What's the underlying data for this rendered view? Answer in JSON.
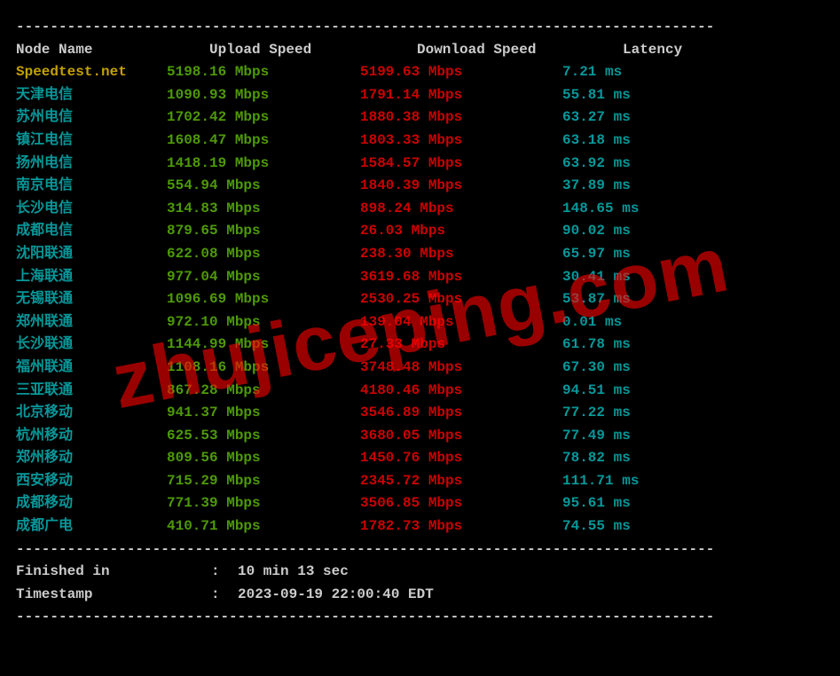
{
  "divider": "----------------------------------------------------------------------------------",
  "headers": {
    "node": "Node Name",
    "upload": "Upload Speed",
    "download": "Download Speed",
    "latency": "Latency"
  },
  "first_row": {
    "node": "Speedtest.net",
    "upload": "5198.16 Mbps",
    "download": "5199.63 Mbps",
    "latency": "7.21 ms"
  },
  "rows": [
    {
      "node": "天津电信",
      "upload": "1090.93 Mbps",
      "download": "1791.14 Mbps",
      "latency": "55.81 ms"
    },
    {
      "node": "苏州电信",
      "upload": "1702.42 Mbps",
      "download": "1880.38 Mbps",
      "latency": "63.27 ms"
    },
    {
      "node": "镇江电信",
      "upload": "1608.47 Mbps",
      "download": "1803.33 Mbps",
      "latency": "63.18 ms"
    },
    {
      "node": "扬州电信",
      "upload": "1418.19 Mbps",
      "download": "1584.57 Mbps",
      "latency": "63.92 ms"
    },
    {
      "node": "南京电信",
      "upload": "554.94 Mbps",
      "download": "1840.39 Mbps",
      "latency": "37.89 ms"
    },
    {
      "node": "长沙电信",
      "upload": "314.83 Mbps",
      "download": "898.24 Mbps",
      "latency": "148.65 ms"
    },
    {
      "node": "成都电信",
      "upload": "879.65 Mbps",
      "download": "26.03 Mbps",
      "latency": "90.02 ms"
    },
    {
      "node": "沈阳联通",
      "upload": "622.08 Mbps",
      "download": "238.30 Mbps",
      "latency": "65.97 ms"
    },
    {
      "node": "上海联通",
      "upload": "977.04 Mbps",
      "download": "3619.68 Mbps",
      "latency": "30.41 ms"
    },
    {
      "node": "无锡联通",
      "upload": "1096.69 Mbps",
      "download": "2530.25 Mbps",
      "latency": "53.87 ms"
    },
    {
      "node": "郑州联通",
      "upload": "972.10 Mbps",
      "download": "139.04 Mbps",
      "latency": "0.01 ms"
    },
    {
      "node": "长沙联通",
      "upload": "1144.99 Mbps",
      "download": "27.33 Mbps",
      "latency": "61.78 ms"
    },
    {
      "node": "福州联通",
      "upload": "1108.16 Mbps",
      "download": "3748.48 Mbps",
      "latency": "67.30 ms"
    },
    {
      "node": "三亚联通",
      "upload": "867.28 Mbps",
      "download": "4180.46 Mbps",
      "latency": "94.51 ms"
    },
    {
      "node": "北京移动",
      "upload": "941.37 Mbps",
      "download": "3546.89 Mbps",
      "latency": "77.22 ms"
    },
    {
      "node": "杭州移动",
      "upload": "625.53 Mbps",
      "download": "3680.05 Mbps",
      "latency": "77.49 ms"
    },
    {
      "node": "郑州移动",
      "upload": "809.56 Mbps",
      "download": "1450.76 Mbps",
      "latency": "78.82 ms"
    },
    {
      "node": "西安移动",
      "upload": "715.29 Mbps",
      "download": "2345.72 Mbps",
      "latency": "111.71 ms"
    },
    {
      "node": "成都移动",
      "upload": "771.39 Mbps",
      "download": "3506.85 Mbps",
      "latency": "95.61 ms"
    },
    {
      "node": "成都广电",
      "upload": "410.71 Mbps",
      "download": "1782.73 Mbps",
      "latency": "74.55 ms"
    }
  ],
  "footer": {
    "finished_label": "Finished in",
    "finished_value": "10 min 13 sec",
    "timestamp_label": "Timestamp",
    "timestamp_value": "2023-09-19 22:00:40 EDT",
    "sep": ":"
  },
  "watermark": "zhujiceping.com"
}
